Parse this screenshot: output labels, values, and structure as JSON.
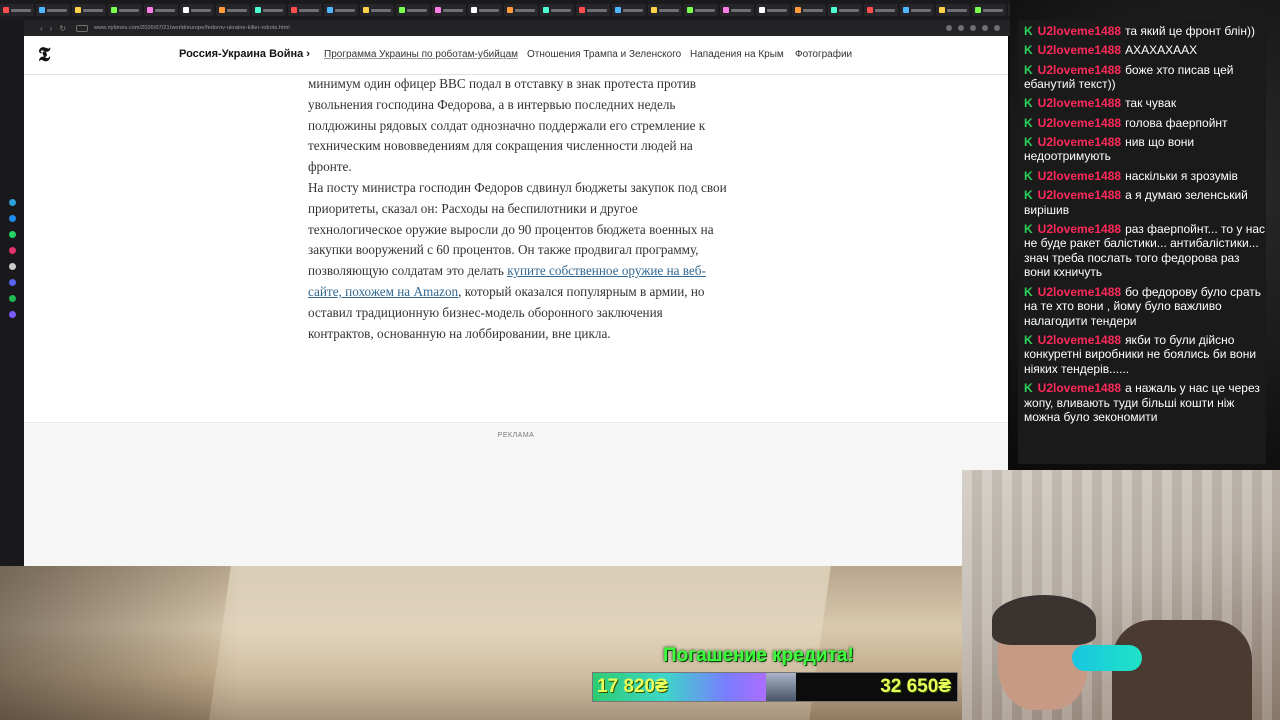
{
  "browser": {
    "url": "www.nytimes.com/2026/07/21/world/europe/fedorov-ukraine-killer-robots.html"
  },
  "site": {
    "logo": "𝕿",
    "section_title": "Россия-Украина Война ›",
    "nav_links": [
      "Программа Украины по роботам-убийцам",
      "Отношения Трампа и Зеленского",
      "Нападения на Крым",
      "Фотографии"
    ]
  },
  "article": {
    "paragraph_1": "минимум один офицер ВВС подал в отставку в знак протеста против увольнения господина Федорова, а в интервью последних недель полдюжины рядовых солдат однозначно поддержали его стремление к техническим нововведениям для сокращения численности людей на фронте.",
    "paragraph_2_before": "На посту министра господин Федоров сдвинул бюджеты закупок под свои приоритеты, сказал он: Расходы на беспилотники и другое технологическое оружие выросли до 90 процентов бюджета военных на закупки вооружений с 60 процентов. Он также продвигал программу, позволяющую солдатам это делать ",
    "paragraph_2_link": "купите собственное оружие на веб-сайте, похожем на Amazon",
    "paragraph_2_after": ", который оказался популярным в армии, но оставил традиционную бизнес-модель оборонного заключения контрактов, основанную на лоббировании, вне цикла."
  },
  "ad": {
    "label": "РЕКЛАМА"
  },
  "chat": {
    "messages": [
      {
        "badge": "K",
        "user": "U2loveme1488",
        "text": "та який це фронт блін))"
      },
      {
        "badge": "K",
        "user": "U2loveme1488",
        "text": "АХАХАХААХ"
      },
      {
        "badge": "K",
        "user": "U2loveme1488",
        "text": "боже хто писав цей ебанутий текст))"
      },
      {
        "badge": "K",
        "user": "U2loveme1488",
        "text": "так чувак"
      },
      {
        "badge": "K",
        "user": "U2loveme1488",
        "text": "голова фаерпойнт"
      },
      {
        "badge": "K",
        "user": "U2loveme1488",
        "text": "нив що вони недоотримують"
      },
      {
        "badge": "K",
        "user": "U2loveme1488",
        "text": "наскільки я зрозумів"
      },
      {
        "badge": "K",
        "user": "U2loveme1488",
        "text": "а я думаю зеленський вирішив"
      },
      {
        "badge": "K",
        "user": "U2loveme1488",
        "text": "раз фаерпойнт... то у нас не буде ракет балістики... антибалістики... знач треба послать того федорова раз вони кхничуть"
      },
      {
        "badge": "K",
        "user": "U2loveme1488",
        "text": "бо федорову було срать на те хто вони , йому було важливо налагодити тендери"
      },
      {
        "badge": "K",
        "user": "U2loveme1488",
        "text": "якби то були дійсно конкуретні виробники не боялись би вони ніяких тендерів......"
      },
      {
        "badge": "K",
        "user": "U2loveme1488",
        "text": "а нажаль у нас це через жопу, вливають туди більші кошти ніж можна було зекономити"
      }
    ]
  },
  "donation": {
    "title": "Погашение кредита!",
    "current": "17 820₴",
    "target": "32 650₴",
    "progress": 0.546
  },
  "colors": {
    "chat_user": "#ff2a5a",
    "chat_badge": "#2bd15a",
    "link": "#326891",
    "goal_title": "#3dff3d"
  }
}
